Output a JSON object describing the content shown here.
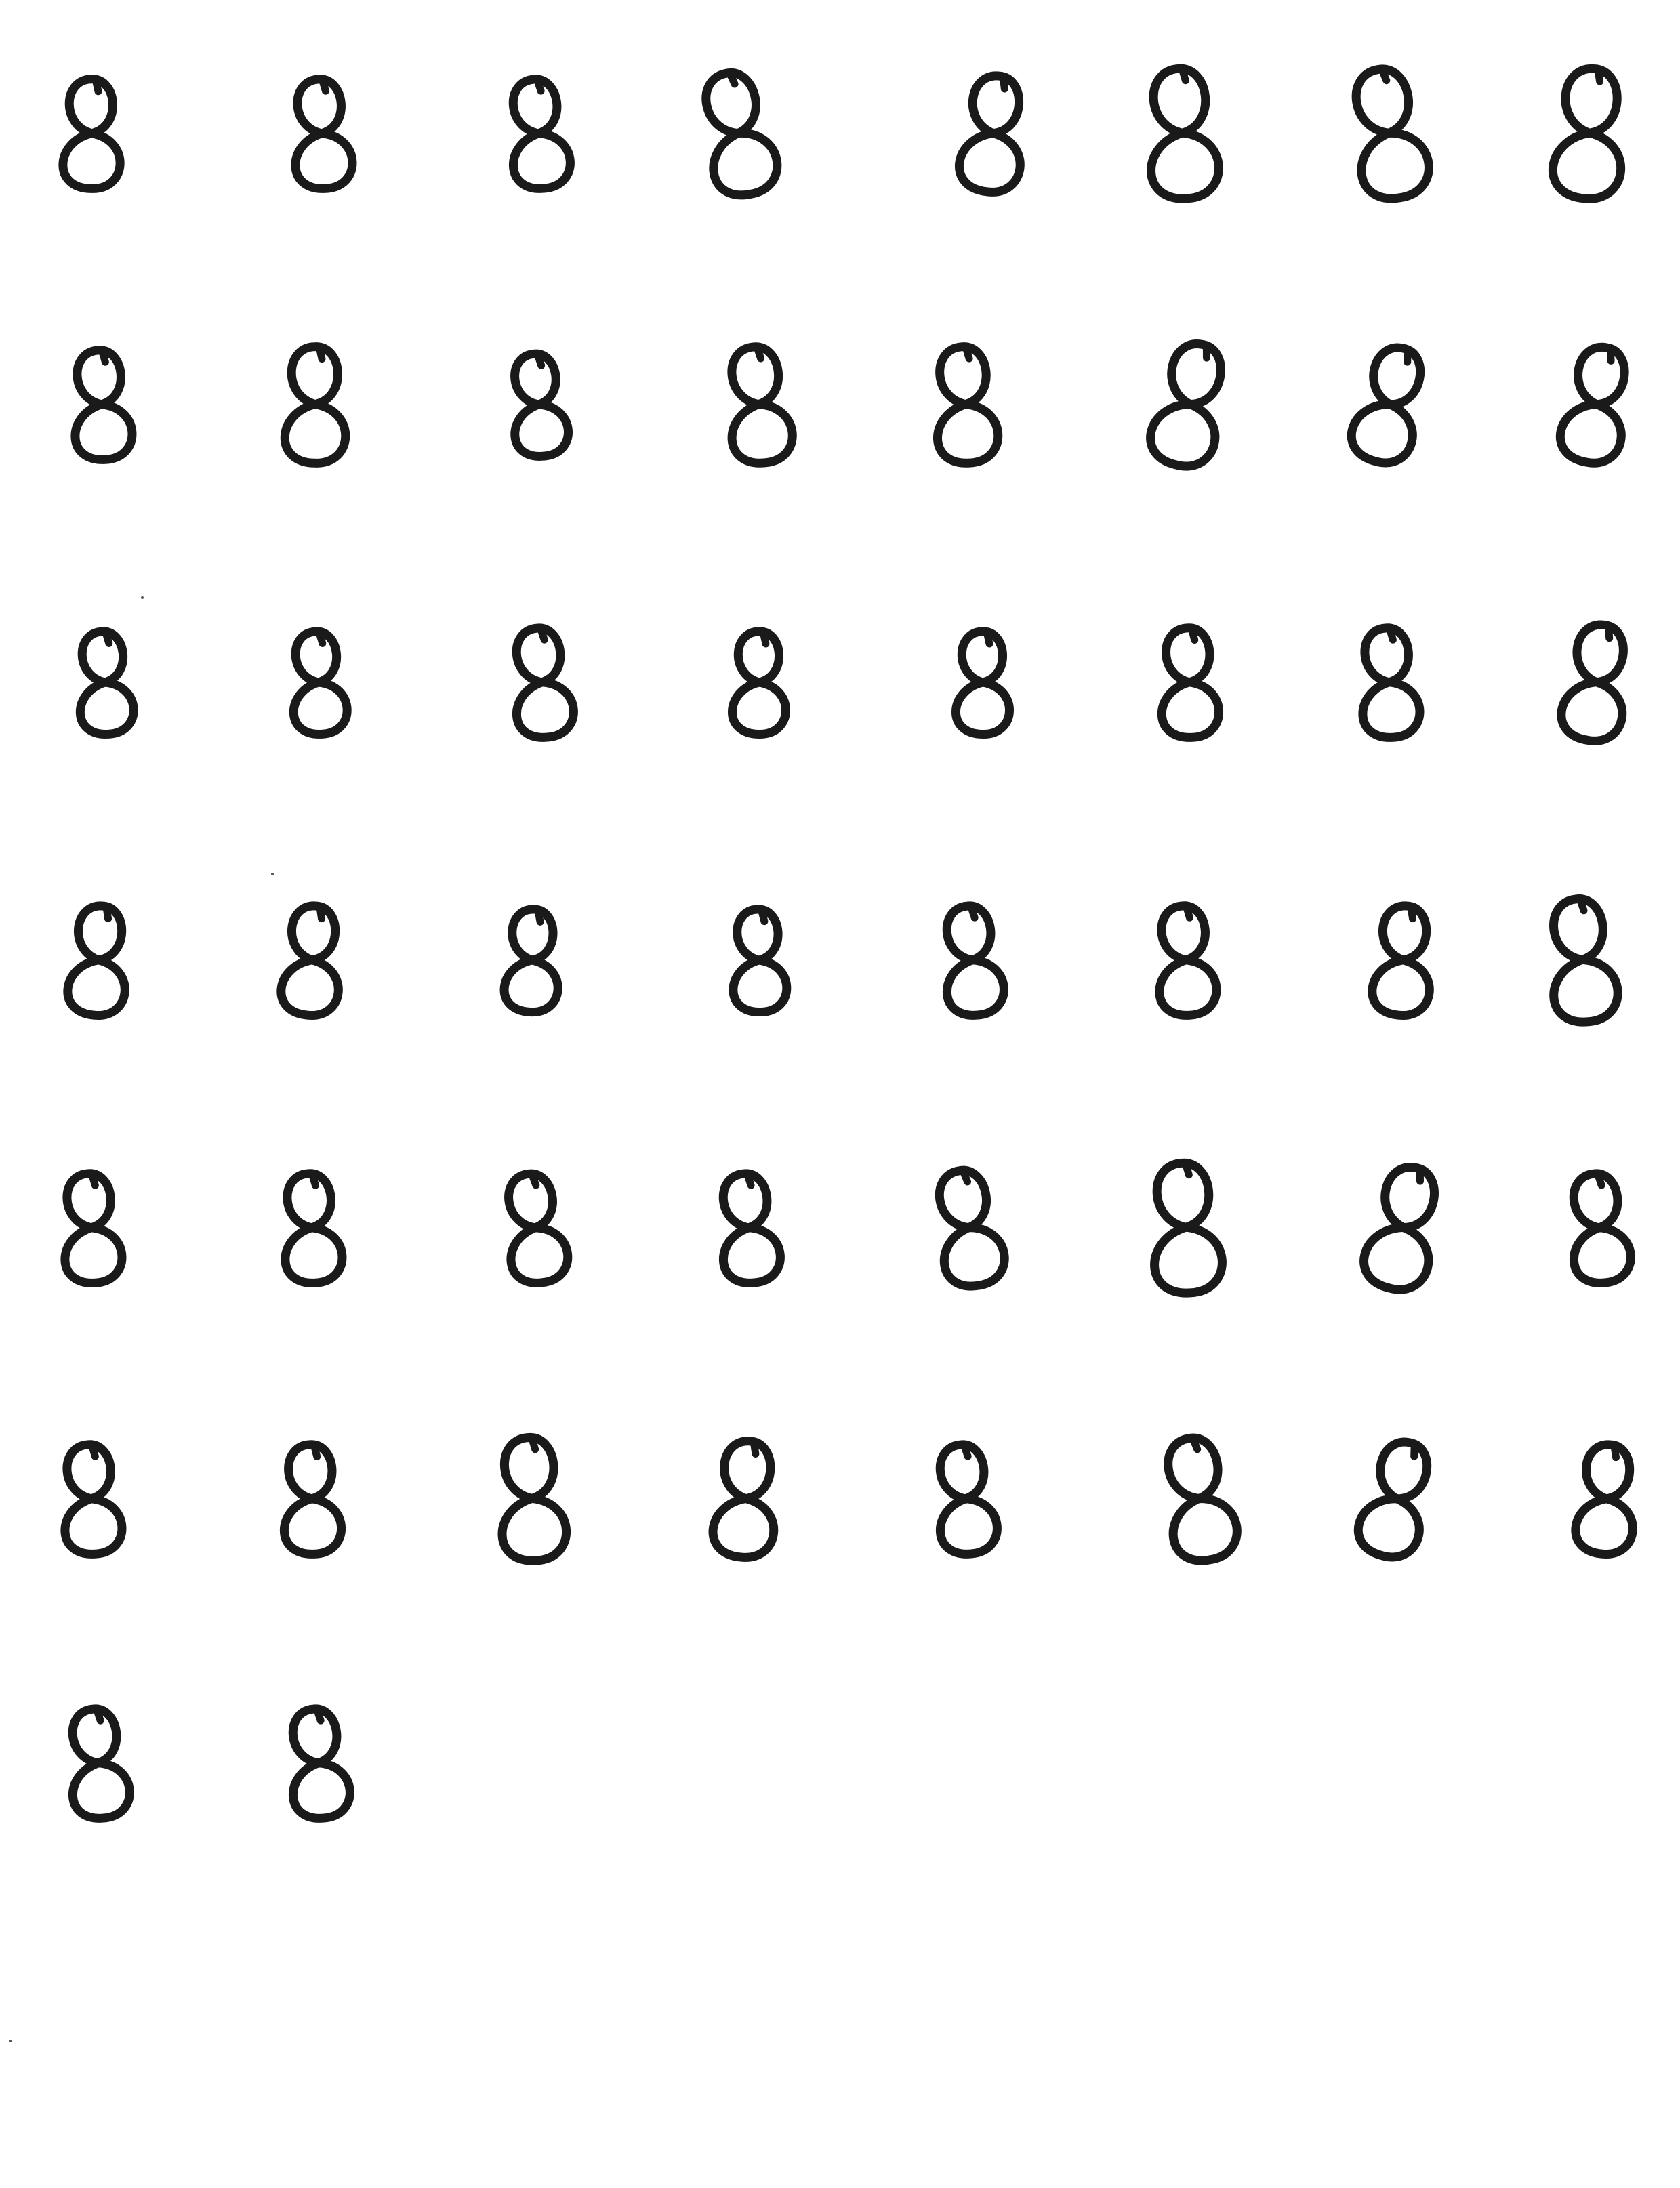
{
  "sheet": {
    "digit": "8",
    "rows": [
      [
        "8",
        "8",
        "8",
        "8",
        "8",
        "8",
        "8",
        "8"
      ],
      [
        "8",
        "8",
        "8",
        "8",
        "8",
        "8",
        "8",
        "8"
      ],
      [
        "8",
        "8",
        "8",
        "8",
        "8",
        "8",
        "8",
        "8"
      ],
      [
        "8",
        "8",
        "8",
        "8",
        "8",
        "8",
        "8",
        "8"
      ],
      [
        "8",
        "8",
        "8",
        "8",
        "8",
        "8",
        "8",
        "8"
      ],
      [
        "8",
        "8",
        "8",
        "8",
        "8",
        "8",
        "8",
        "8"
      ],
      [
        "8",
        "8"
      ]
    ],
    "ink_color": "#1a1a1a",
    "paper_color": "#ffffff"
  }
}
